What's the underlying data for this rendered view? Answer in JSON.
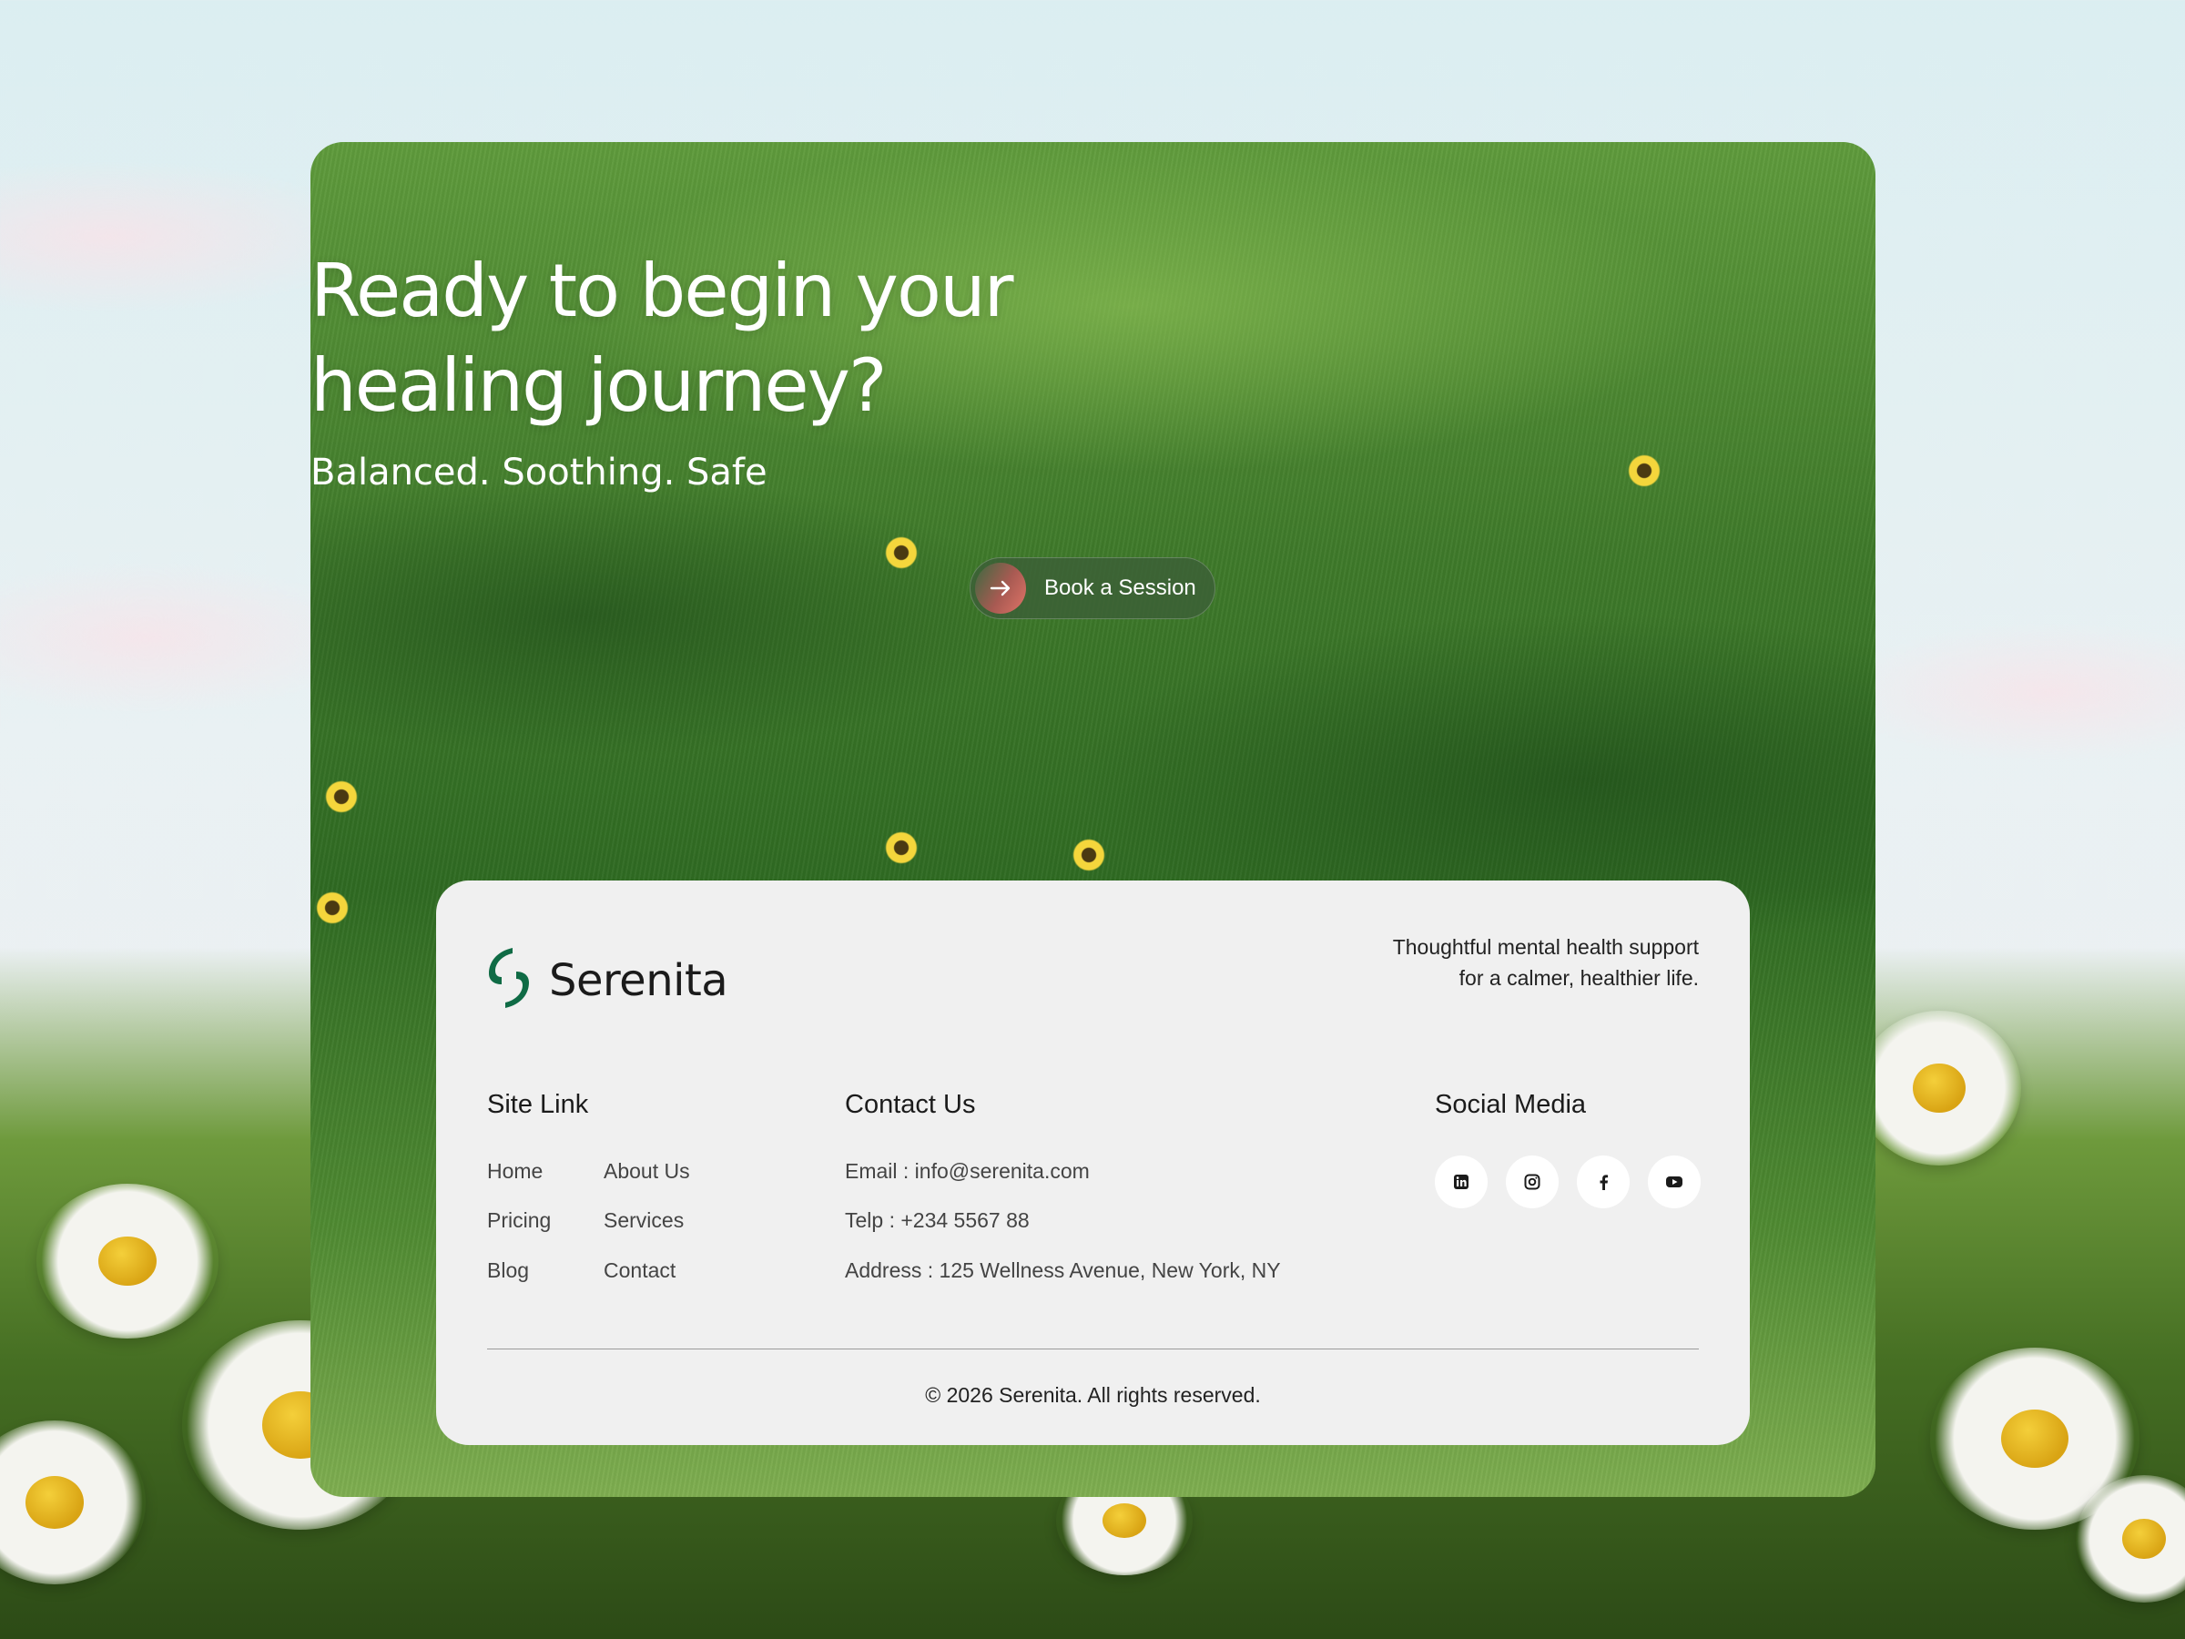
{
  "hero": {
    "title_line1": "Ready to begin your",
    "title_line2": "healing journey?",
    "subtitle": "Balanced. Soothing. Safe",
    "cta_label": "Book a Session"
  },
  "footer": {
    "brand_name": "Serenita",
    "tagline": "Thoughtful mental health support for a calmer, healthier life.",
    "site_links": {
      "title": "Site Link",
      "items": [
        "Home",
        "About Us",
        "Pricing",
        "Services",
        "Blog",
        "Contact"
      ]
    },
    "contact": {
      "title": "Contact Us",
      "email": "Email : info@serenita.com",
      "phone": "Telp : +234 5567 88",
      "address": "Address : 125 Wellness Avenue, New York, NY"
    },
    "social": {
      "title": "Social Media",
      "icons": [
        "linkedin-icon",
        "instagram-icon",
        "facebook-icon",
        "youtube-icon"
      ]
    },
    "copyright": "© 2026 Serenita. All rights reserved."
  },
  "colors": {
    "brand_green": "#0f6b45",
    "footer_bg": "#f0f0f0",
    "cta_bg": "#3c5f37",
    "cta_accent": "#e07468"
  }
}
